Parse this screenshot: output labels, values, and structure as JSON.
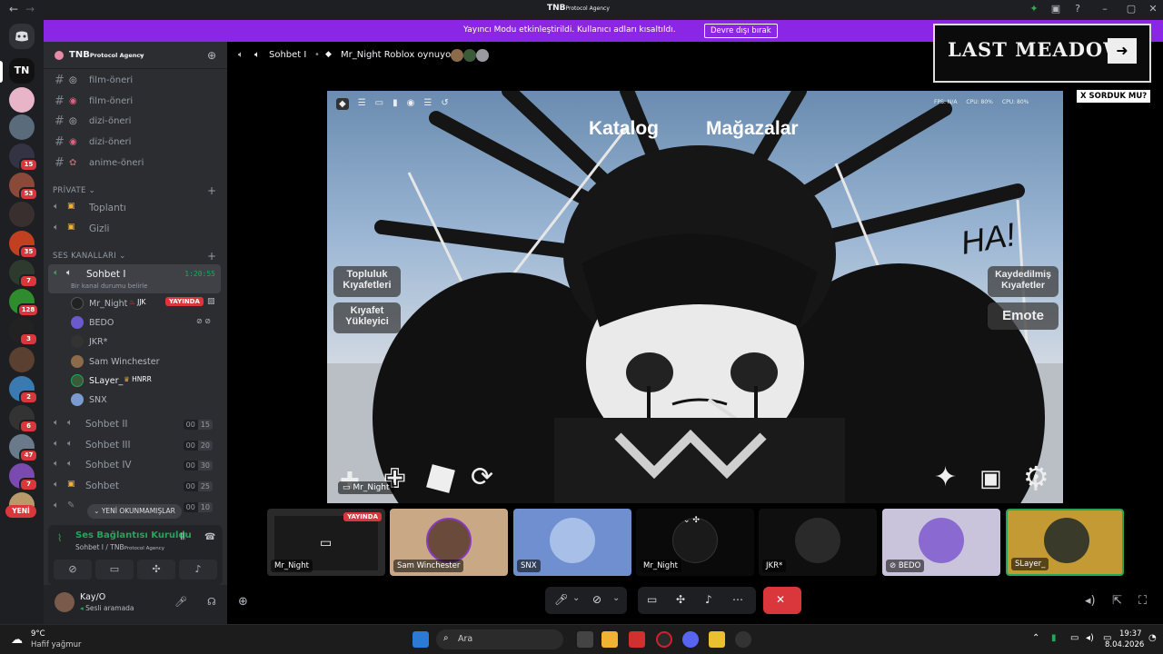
{
  "window": {
    "title": "TNB",
    "title_sub": "Protocol Agency",
    "back": "←",
    "forward": "→"
  },
  "banner": {
    "text": "Yayıncı Modu etkinleştirildi. Kullanıcı adları kısaltıldı.",
    "button": "Devre dışı bırak"
  },
  "server": {
    "name": "TNB",
    "sub": "Protocol Agency"
  },
  "channels": [
    {
      "label": "film-öneri"
    },
    {
      "label": "film-öneri"
    },
    {
      "label": "dizi-öneri"
    },
    {
      "label": "dizi-öneri"
    },
    {
      "label": "anime-öneri"
    }
  ],
  "private": {
    "title": "PRİVATE",
    "items": [
      {
        "label": "Toplantı"
      },
      {
        "label": "Gizli"
      }
    ]
  },
  "voice_section": {
    "title": "SES KANALLARI"
  },
  "active_voice": {
    "label": "Sohbet I",
    "timer": "1:20:55",
    "status": "Bir kanal durumu belirle"
  },
  "voice_users": [
    {
      "name": "Mr_Night",
      "tag": "JJK",
      "live": "YAYINDA"
    },
    {
      "name": "BEDO"
    },
    {
      "name": "JKR*"
    },
    {
      "name": "Sam Winchester"
    },
    {
      "name": "SLayer_",
      "tag": "HNRR"
    },
    {
      "name": "SNX"
    }
  ],
  "other_voice": [
    {
      "label": "Sohbet II",
      "a": "00",
      "b": "15"
    },
    {
      "label": "Sohbet III",
      "a": "00",
      "b": "20"
    },
    {
      "label": "Sohbet IV",
      "a": "00",
      "b": "30"
    },
    {
      "label": "Sohbet",
      "a": "00",
      "b": "25"
    },
    {
      "label": "",
      "a": "00",
      "b": "10"
    }
  ],
  "unread_pill": "YENİ OKUNMAMIŞLAR",
  "new_pill": "YENİ",
  "server_badges": [
    "15",
    "53",
    "35",
    "7",
    "128",
    "3",
    "2",
    "6",
    "47",
    "7"
  ],
  "connection": {
    "title": "Ses Bağlantısı Kuruldu",
    "sub": "Sohbet I / TNB",
    "sub2": "Protocol Agency"
  },
  "user": {
    "name": "Kay/O",
    "status": "Sesli aramada"
  },
  "header": {
    "channel": "Sohbet I",
    "activity": "Mr_Night Roblox oynuyor"
  },
  "game": {
    "top_tabs": [
      "Katalog",
      "Mağazalar"
    ],
    "left_buttons": [
      "Topluluk Kıyafetleri",
      "Kıyafet Yükleyici"
    ],
    "right_buttons": [
      "Kaydedilmiş Kıyafetler",
      "Emote"
    ],
    "stats": [
      "FPS: N/A",
      "CPU: 80%",
      "CPU: 80%"
    ],
    "streamer": "Mr_Night"
  },
  "overlay": {
    "title": "LAST MEADOW",
    "sub": "X SORDUK MU?"
  },
  "tiles": [
    {
      "name": "Mr_Night",
      "live": "YAYINDA"
    },
    {
      "name": "Sam Winchester"
    },
    {
      "name": "SNX"
    },
    {
      "name": "Mr_Night"
    },
    {
      "name": "JKR*"
    },
    {
      "name": "BEDO"
    },
    {
      "name": "SLayer_"
    }
  ],
  "taskbar": {
    "weather_temp": "9°C",
    "weather_desc": "Hafif yağmur",
    "search": "Ara",
    "time": "19:37",
    "date": "8.04.2026"
  },
  "colors": {
    "accent": "#8b26e5",
    "danger": "#da373c",
    "online": "#23a55a"
  }
}
